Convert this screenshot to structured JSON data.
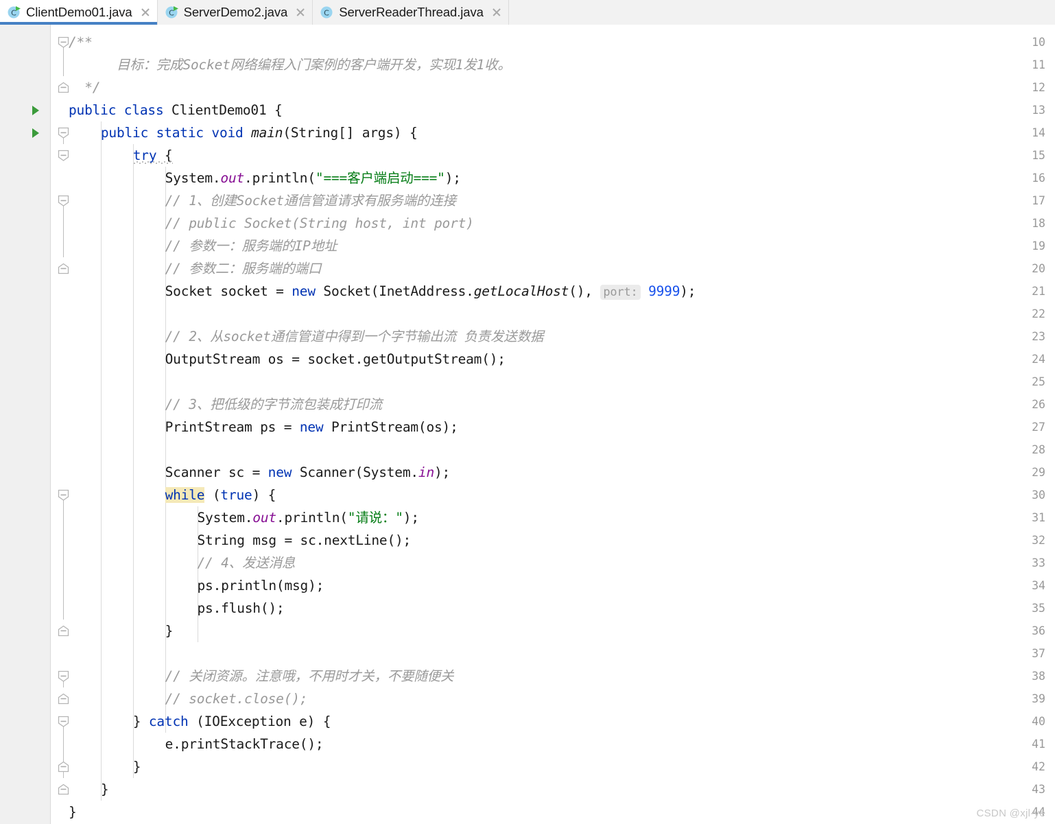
{
  "window": {
    "app": "IntelliJ IDEA Editor",
    "watermark": "CSDN @xjl-ye"
  },
  "tabs": [
    {
      "label": "ClientDemo01.java",
      "icon": "java-runnable-class-icon",
      "active": true,
      "runnable": true,
      "close_icon": "close-icon"
    },
    {
      "label": "ServerDemo2.java",
      "icon": "java-runnable-class-icon",
      "active": false,
      "runnable": true,
      "close_icon": "close-icon"
    },
    {
      "label": "ServerReaderThread.java",
      "icon": "java-class-icon",
      "active": false,
      "runnable": false,
      "close_icon": "close-icon"
    }
  ],
  "colors": {
    "accent_tab_underline": "#4681c4",
    "keyword": "#0033b3",
    "string": "#067d17",
    "comment": "#9a9a9a",
    "static_field": "#871094",
    "number": "#1750eb",
    "highlight": "#f5e9b8",
    "gutter_bg": "#f0f0f0",
    "tabbar_bg": "#f2f2f2",
    "run_arrow": "#3b9b3b"
  },
  "editor": {
    "first_line": 10,
    "last_line": 44,
    "line_numbers": [
      10,
      11,
      12,
      13,
      14,
      15,
      16,
      17,
      18,
      19,
      20,
      21,
      22,
      23,
      24,
      25,
      26,
      27,
      28,
      29,
      30,
      31,
      32,
      33,
      34,
      35,
      36,
      37,
      38,
      39,
      40,
      41,
      42,
      43,
      44
    ],
    "run_arrow_lines": [
      13,
      14
    ],
    "parameter_hint": {
      "label": "port:",
      "value": "9999"
    },
    "highlighted_token": "while",
    "lines": [
      {
        "n": 10,
        "text": "/**"
      },
      {
        "n": 11,
        "text": "    目标：完成Socket网络编程入门案例的客户端开发，实现1发1收。"
      },
      {
        "n": 12,
        "text": " */"
      },
      {
        "n": 13,
        "text": "public class ClientDemo01 {"
      },
      {
        "n": 14,
        "text": "    public static void main(String[] args) {"
      },
      {
        "n": 15,
        "text": "        try {"
      },
      {
        "n": 16,
        "text": "            System.out.println(\"===客户端启动===\");"
      },
      {
        "n": 17,
        "text": "            // 1、创建Socket通信管道请求有服务端的连接"
      },
      {
        "n": 18,
        "text": "            // public Socket(String host, int port)"
      },
      {
        "n": 19,
        "text": "            // 参数一：服务端的IP地址"
      },
      {
        "n": 20,
        "text": "            // 参数二：服务端的端口"
      },
      {
        "n": 21,
        "text": "            Socket socket = new Socket(InetAddress.getLocalHost(), port: 9999);"
      },
      {
        "n": 22,
        "text": ""
      },
      {
        "n": 23,
        "text": "            // 2、从socket通信管道中得到一个字节输出流 负责发送数据"
      },
      {
        "n": 24,
        "text": "            OutputStream os = socket.getOutputStream();"
      },
      {
        "n": 25,
        "text": ""
      },
      {
        "n": 26,
        "text": "            // 3、把低级的字节流包装成打印流"
      },
      {
        "n": 27,
        "text": "            PrintStream ps = new PrintStream(os);"
      },
      {
        "n": 28,
        "text": ""
      },
      {
        "n": 29,
        "text": "            Scanner sc = new Scanner(System.in);"
      },
      {
        "n": 30,
        "text": "            while (true) {"
      },
      {
        "n": 31,
        "text": "                System.out.println(\"请说：\");"
      },
      {
        "n": 32,
        "text": "                String msg = sc.nextLine();"
      },
      {
        "n": 33,
        "text": "                // 4、发送消息"
      },
      {
        "n": 34,
        "text": "                ps.println(msg);"
      },
      {
        "n": 35,
        "text": "                ps.flush();"
      },
      {
        "n": 36,
        "text": "            }"
      },
      {
        "n": 37,
        "text": ""
      },
      {
        "n": 38,
        "text": "            // 关闭资源。注意哦，不用时才关，不要随便关"
      },
      {
        "n": 39,
        "text": "            // socket.close();"
      },
      {
        "n": 40,
        "text": "        } catch (IOException e) {"
      },
      {
        "n": 41,
        "text": "            e.printStackTrace();"
      },
      {
        "n": 42,
        "text": "        }"
      },
      {
        "n": 43,
        "text": "    }"
      },
      {
        "n": 44,
        "text": "}"
      }
    ],
    "tokens": {
      "l10": {
        "a": "/**"
      },
      "l11": {
        "a": "  目标：完成Socket网络编程入门案例的客户端开发，实现1发1收。"
      },
      "l12": {
        "a": " */"
      },
      "l13": {
        "a": "public class ",
        "b": "ClientDemo01 {"
      },
      "l14": {
        "a": "public static void ",
        "b": "main",
        "c": "(String[] args) {"
      },
      "l15": {
        "a": "try",
        "b": " {"
      },
      "l16": {
        "a": "System.",
        "b": "out",
        "c": ".println(",
        "d": "\"===客户端启动===\"",
        "e": ");"
      },
      "l17": {
        "a": "// 1、创建Socket通信管道请求有服务端的连接"
      },
      "l18": {
        "a": "// public Socket(String host, int port)"
      },
      "l19": {
        "a": "// 参数一：服务端的IP地址"
      },
      "l20": {
        "a": "// 参数二：服务端的端口"
      },
      "l21": {
        "a": "Socket socket = ",
        "b": "new",
        "c": " Socket(InetAddress.",
        "d": "getLocalHost",
        "e": "(), ",
        "f": "port:",
        "g": "9999",
        "h": ");"
      },
      "l23": {
        "a": "// 2、从socket通信管道中得到一个字节输出流 负责发送数据"
      },
      "l24": {
        "a": "OutputStream os = socket.getOutputStream();"
      },
      "l26": {
        "a": "// 3、把低级的字节流包装成打印流"
      },
      "l27": {
        "a": "PrintStream ps = ",
        "b": "new",
        "c": " PrintStream(os);"
      },
      "l29": {
        "a": "Scanner sc = ",
        "b": "new",
        "c": " Scanner(System.",
        "d": "in",
        "e": ");"
      },
      "l30": {
        "a": "while",
        "b": " (",
        "c": "true",
        "d": ") {"
      },
      "l31": {
        "a": "System.",
        "b": "out",
        "c": ".println(",
        "d": "\"请说：\"",
        "e": ");"
      },
      "l32": {
        "a": "String msg = sc.nextLine();"
      },
      "l33": {
        "a": "// 4、发送消息"
      },
      "l34": {
        "a": "ps.println(msg);"
      },
      "l35": {
        "a": "ps.flush();"
      },
      "l36": {
        "a": "}"
      },
      "l38": {
        "a": "// 关闭资源。注意哦，不用时才关，不要随便关"
      },
      "l39": {
        "a": "// socket.close();"
      },
      "l40": {
        "a": "} ",
        "b": "catch",
        "c": " (IOException e) {"
      },
      "l41": {
        "a": "e.printStackTrace();"
      },
      "l42": {
        "a": "}"
      },
      "l43": {
        "a": "}"
      },
      "l44": {
        "a": "}"
      }
    }
  }
}
